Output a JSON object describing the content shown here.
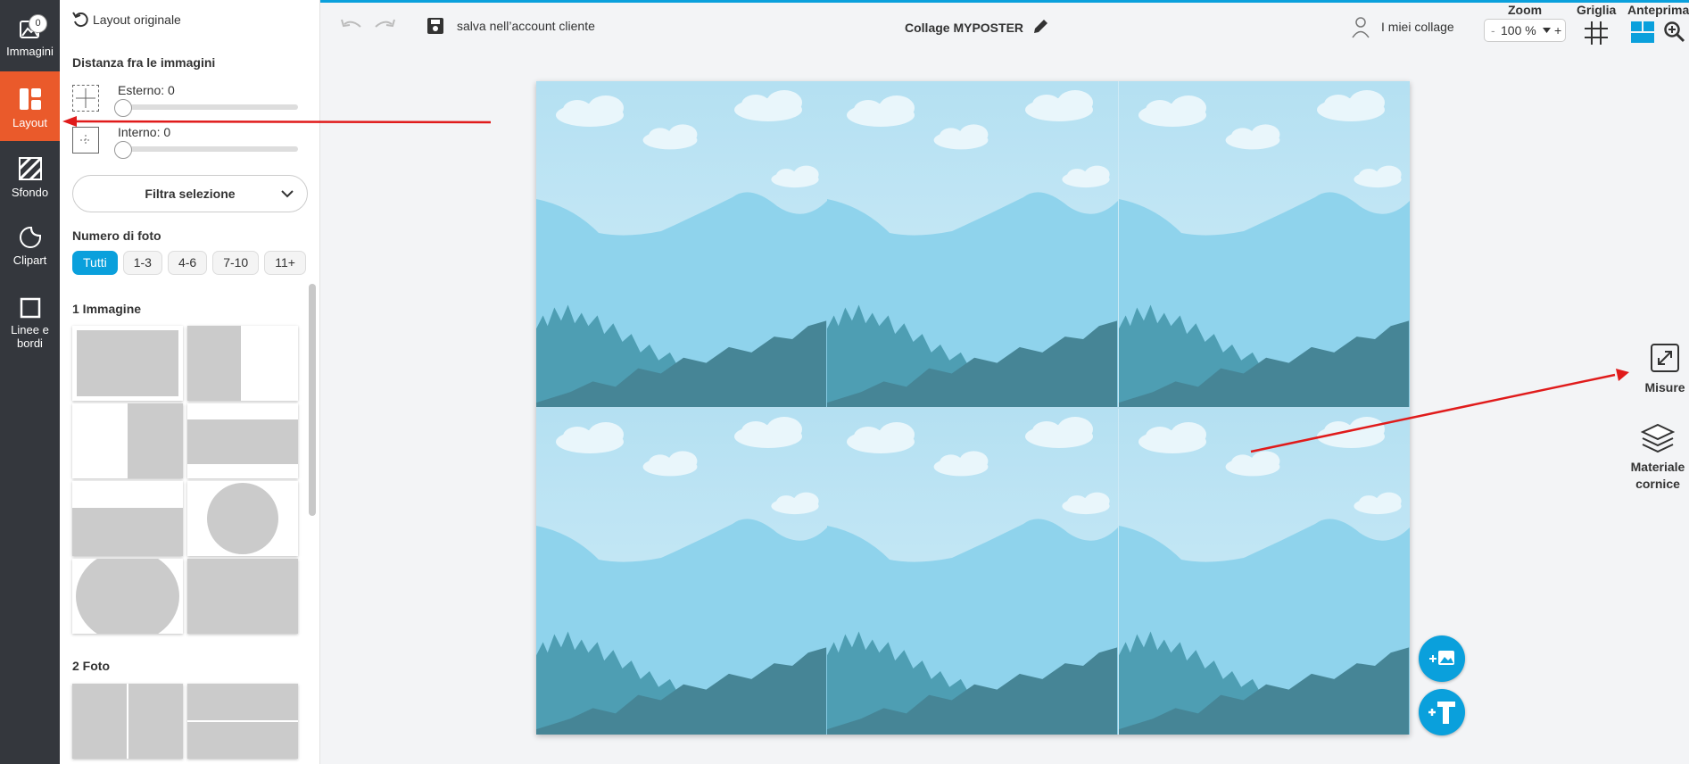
{
  "rail": {
    "images_label": "Immagini",
    "images_count": "0",
    "layout_label": "Layout",
    "background_label": "Sfondo",
    "clipart_label": "Clipart",
    "lines_label": "Linee e bordi"
  },
  "panel": {
    "reset_label": "Layout originale",
    "spacing_title": "Distanza fra le immagini",
    "outer_label": "Esterno: 0",
    "inner_label": "Interno: 0",
    "outer_value": 0,
    "inner_value": 0,
    "filter_label": "Filtra selezione",
    "photo_count_title": "Numero di foto",
    "filters": [
      "Tutti",
      "1-3",
      "4-6",
      "7-10",
      "11+"
    ],
    "active_filter": "Tutti",
    "section_one": "1 Immagine",
    "section_two": "2 Foto"
  },
  "toolbar": {
    "save_label": "salva nell’account cliente",
    "title": "Collage MYPOSTER",
    "my_collages": "I miei collage",
    "zoom_title": "Zoom",
    "zoom_minus": "-",
    "zoom_value": "100 %",
    "zoom_plus": "+",
    "grid_title": "Griglia",
    "preview_title": "Anteprima"
  },
  "right": {
    "size_label": "Misure",
    "material_label_1": "Materiale",
    "material_label_2": "cornice"
  },
  "colors": {
    "accent": "#0aa0dc",
    "active_rail": "#ea5a2b",
    "rail_bg": "#34373d",
    "annotation_arrow": "#e01b1b"
  }
}
